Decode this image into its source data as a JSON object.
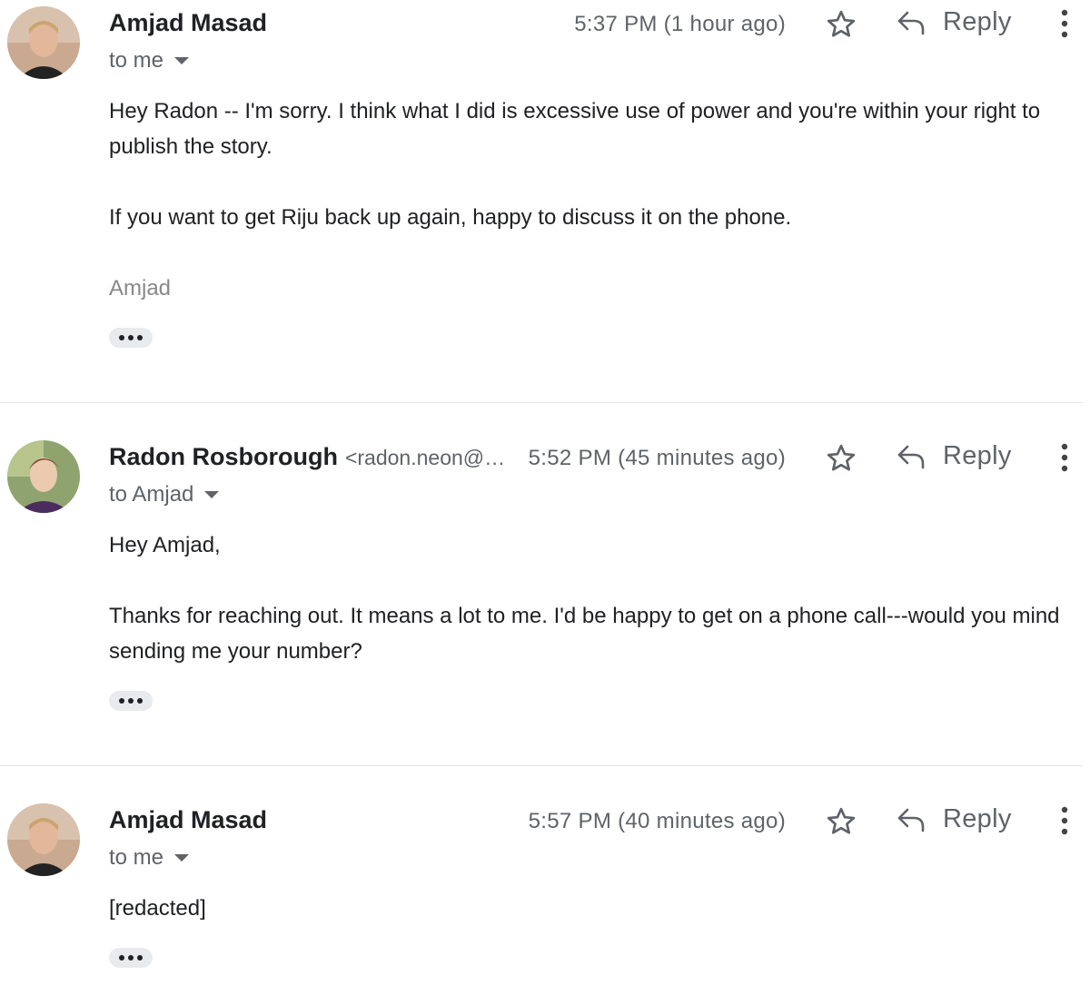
{
  "messages": [
    {
      "sender": "Amjad Masad",
      "sender_email": "",
      "recipient": "to me",
      "time": "5:37 PM (1 hour ago)",
      "reply_label": "Reply",
      "body": [
        "Hey Radon -- I'm sorry. I think what I did is excessive use of power and you're within your right to publish the story.",
        "If you want to get Riju back up again, happy to discuss it on the phone."
      ],
      "signature": "Amjad",
      "avatar_icon": "avatar-amjad"
    },
    {
      "sender": "Radon Rosborough",
      "sender_email": "<radon.neon@…",
      "recipient": "to Amjad",
      "time": "5:52 PM (45 minutes ago)",
      "reply_label": "Reply",
      "body": [
        "Hey Amjad,",
        "Thanks for reaching out. It means a lot to me. I'd be happy to get on a phone call---would you mind sending me your number?"
      ],
      "signature": "",
      "avatar_icon": "avatar-radon"
    },
    {
      "sender": "Amjad Masad",
      "sender_email": "",
      "recipient": "to me",
      "time": "5:57 PM (40 minutes ago)",
      "reply_label": "Reply",
      "body": [
        "[redacted]"
      ],
      "signature": "",
      "avatar_icon": "avatar-amjad"
    }
  ],
  "colors": {
    "text": "#202124",
    "secondary": "#5f6368",
    "signature": "#888888",
    "divider": "#e3e3e3",
    "ellipsis_bg": "#e8eaed"
  }
}
